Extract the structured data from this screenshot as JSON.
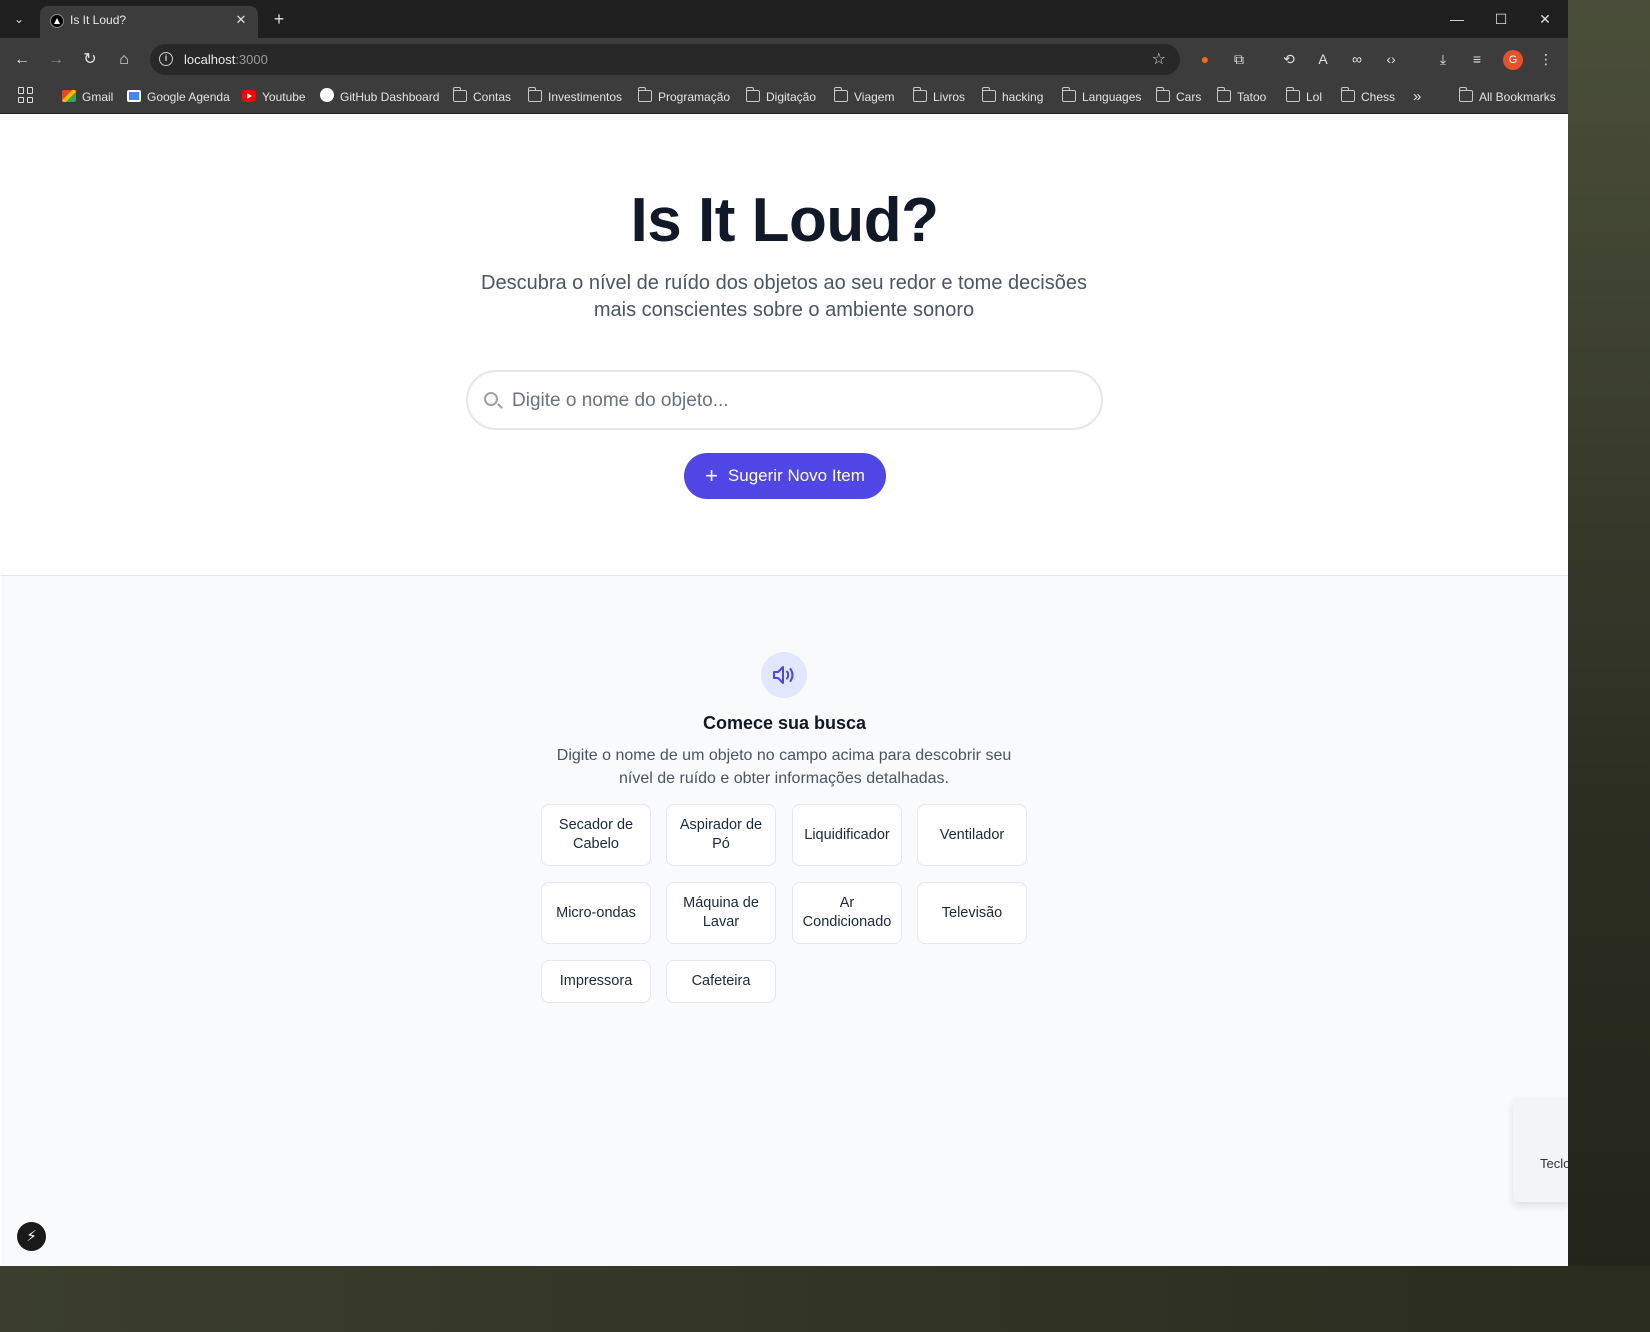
{
  "browser": {
    "tab_title": "Is It Loud?",
    "url_host": "localhost",
    "url_port": ":3000",
    "avatar_letter": "G",
    "bookmarks": [
      "Gmail",
      "Google Agenda",
      "Youtube",
      "GitHub Dashboard",
      "Contas",
      "Investimentos",
      "Programação",
      "Digitação",
      "Viagem",
      "Livros",
      "hacking",
      "Languages",
      "Cars",
      "Tatoo",
      "Lol",
      "Chess"
    ],
    "all_bookmarks": "All Bookmarks",
    "more_bookmarks": "»"
  },
  "hero": {
    "title": "Is It Loud?",
    "subtitle": "Descubra o nível de ruído dos objetos ao seu redor e tome decisões mais conscientes sobre o ambiente sonoro",
    "search_placeholder": "Digite o nome do objeto...",
    "suggest_label": "Sugerir Novo Item"
  },
  "start": {
    "title": "Comece sua busca",
    "description": "Digite o nome de um objeto no campo acima para descobrir seu nível de ruído e obter informações detalhadas.",
    "chips": [
      "Secador de Cabelo",
      "Aspirador de Pó",
      "Liquidificador",
      "Ventilador",
      "Micro-ondas",
      "Máquina de Lavar",
      "Ar Condicionado",
      "Televisão",
      "Impressora",
      "Cafeteira"
    ]
  },
  "overlay": {
    "next_badge": "⚡",
    "side_popup_text": "Teclo"
  },
  "colors": {
    "accent": "#4f46e5",
    "title": "#111827",
    "muted": "#4b5563",
    "lower_bg": "#f9fafb"
  }
}
